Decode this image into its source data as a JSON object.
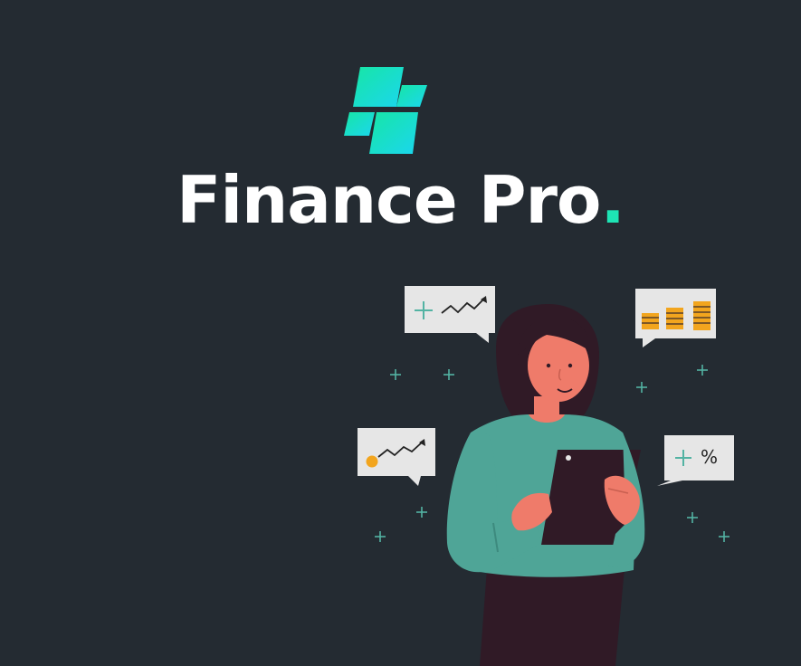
{
  "brand": {
    "name": "Finance Pro",
    "dot": ".",
    "accent_color": "#1ee4b5",
    "logo_colors": [
      "#17e6a5",
      "#1bd6ee"
    ]
  },
  "bubbles": {
    "percent_bubble_text": "%"
  },
  "colors": {
    "background": "#242b32",
    "sweater": "#4fa597",
    "skin": "#ef7b6a",
    "hair": "#301a26",
    "bubble": "#e6e6e6"
  },
  "icons": [
    "logo-icon",
    "plus-icon",
    "trend-chart-icon",
    "coin-stack-icon",
    "percent-icon"
  ]
}
